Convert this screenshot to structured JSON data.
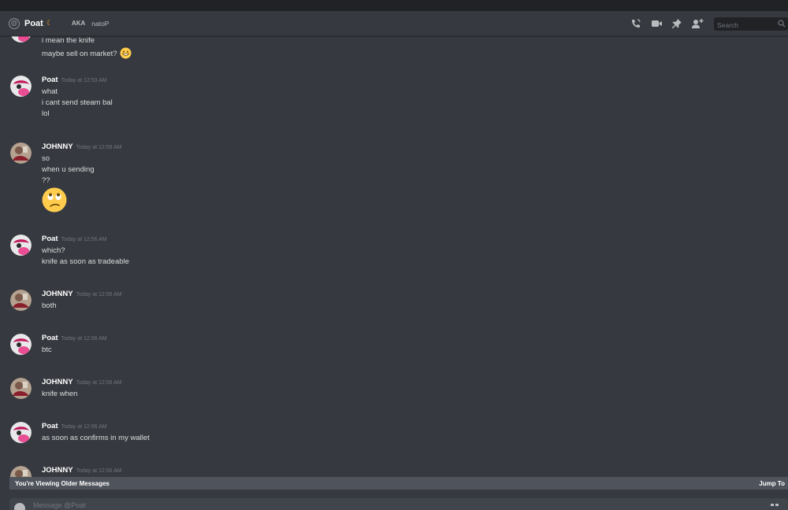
{
  "header": {
    "title": "Poat",
    "status_glyph": "☾",
    "aka_label": "AKA",
    "alias": "natoP",
    "icons": [
      "call-icon",
      "video-icon",
      "pin-icon",
      "add-friend-icon"
    ],
    "search_placeholder": "Search"
  },
  "colors": {
    "background": "#36393f",
    "topbar": "#202225",
    "username": "#ffffff",
    "timestamp": "#72767d",
    "text": "#dcddde",
    "older_bar": "#4f545c",
    "poat_avatar": "#e94d93",
    "johnny_avatar": "#b5a18f"
  },
  "messages": [
    {
      "author": "",
      "time": "",
      "lines": [
        "i mean the knife",
        "maybe sell on market?"
      ],
      "emoji_inline": "grinning-emoji"
    },
    {
      "author": "Poat",
      "time": "Today at 12:53 AM",
      "lines": [
        "what",
        "i cant send steam bal",
        "lol"
      ]
    },
    {
      "author": "JOHNNY",
      "time": "Today at 12:56 AM",
      "lines": [
        "so",
        "when u sending",
        "??"
      ],
      "emoji_large": "eye-roll-emoji"
    },
    {
      "author": "Poat",
      "time": "Today at 12:56 AM",
      "lines": [
        "which?",
        "knife as soon as tradeable"
      ]
    },
    {
      "author": "JOHNNY",
      "time": "Today at 12:56 AM",
      "lines": [
        "both"
      ]
    },
    {
      "author": "Poat",
      "time": "Today at 12:56 AM",
      "lines": [
        "btc"
      ]
    },
    {
      "author": "JOHNNY",
      "time": "Today at 12:56 AM",
      "lines": [
        "knife when"
      ]
    },
    {
      "author": "Poat",
      "time": "Today at 12:56 AM",
      "lines": [
        "as soon as confirms in my wallet"
      ]
    },
    {
      "author": "JOHNNY",
      "time": "Today at 12:56 AM",
      "lines": []
    }
  ],
  "older_bar": {
    "label": "You're Viewing Older Messages",
    "jump_label": "Jump To"
  },
  "composer": {
    "placeholder": "Message @Poat"
  }
}
